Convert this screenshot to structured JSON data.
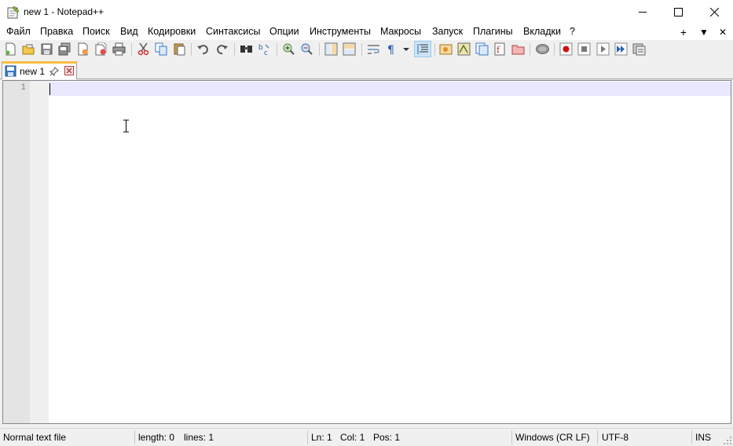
{
  "window": {
    "title": "new 1 - Notepad++"
  },
  "menu": {
    "items": [
      "Файл",
      "Правка",
      "Поиск",
      "Вид",
      "Кодировки",
      "Синтаксисы",
      "Опции",
      "Инструменты",
      "Макросы",
      "Запуск",
      "Плагины",
      "Вкладки",
      "?"
    ],
    "right_glyphs": [
      "+",
      "▼",
      "✕"
    ]
  },
  "toolbar": {
    "icons": [
      "new-file-icon",
      "open-file-icon",
      "save-icon",
      "save-all-icon",
      "close-icon",
      "close-all-icon",
      "print-icon",
      "cut-icon",
      "copy-icon",
      "paste-icon",
      "undo-icon",
      "redo-icon",
      "find-icon",
      "replace-icon",
      "zoom-in-icon",
      "zoom-out-icon",
      "sync-vertical-icon",
      "sync-horizontal-icon",
      "word-wrap-icon",
      "show-all-chars-icon",
      "indent-guide-icon",
      "user-defined-language-icon",
      "document-map-icon",
      "function-list-icon",
      "folder-as-workspace-icon",
      "document-list-icon",
      "monitoring-icon",
      "macro-record-icon",
      "macro-stop-icon",
      "macro-play-icon",
      "macro-run-multiple-icon",
      "macro-save-icon"
    ]
  },
  "tabs": [
    {
      "label": "new 1",
      "active": true
    }
  ],
  "editor": {
    "lines": [
      "1"
    ]
  },
  "status": {
    "language": "Normal text file",
    "length": "length: 0",
    "lines": "lines: 1",
    "ln": "Ln: 1",
    "col": "Col: 1",
    "pos": "Pos: 1",
    "eol": "Windows (CR LF)",
    "encoding": "UTF-8",
    "mode": "INS"
  },
  "colors": {
    "tab_accent": "#fabc41",
    "current_line": "#e8e8ff",
    "gutter": "#e4e4e4"
  }
}
